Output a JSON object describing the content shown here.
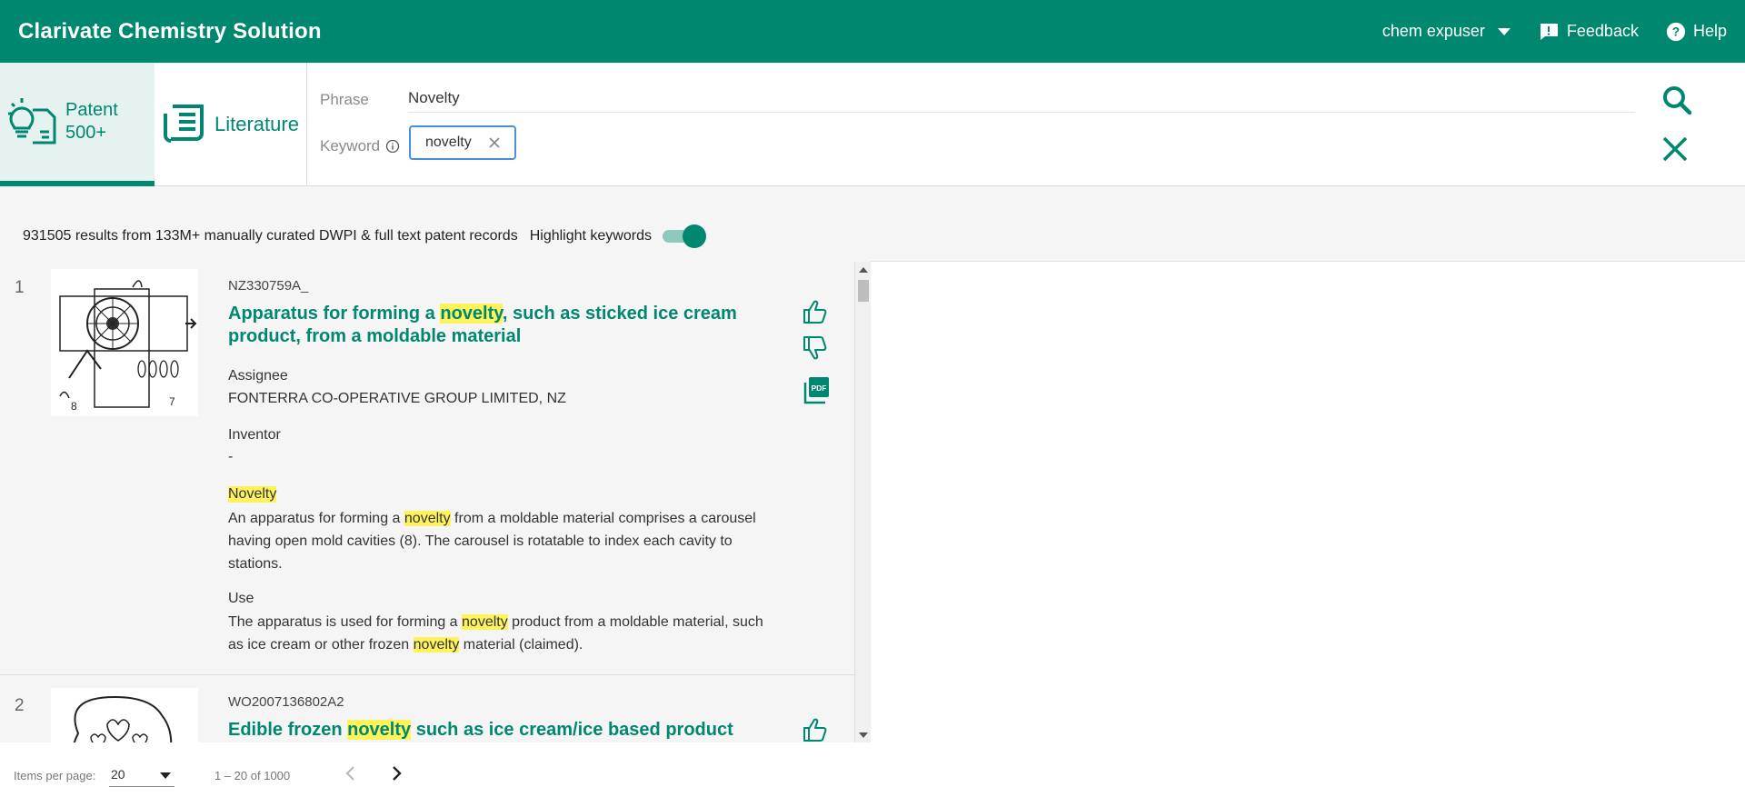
{
  "app": {
    "title": "Clarivate Chemistry Solution"
  },
  "header": {
    "user": "chem expuser",
    "feedback": "Feedback",
    "help": "Help"
  },
  "tabs": {
    "patent": {
      "line1": "Patent",
      "line2": "500+"
    },
    "literature": "Literature"
  },
  "search": {
    "phrase_label": "Phrase",
    "phrase_value": "Novelty",
    "keyword_label": "Keyword",
    "keyword_chip": "novelty"
  },
  "results": {
    "summary": "931505 results from 133M+ manually curated DWPI & full text patent records",
    "highlight_label": "Highlight keywords",
    "highlight_on": true
  },
  "items": [
    {
      "num": "1",
      "patent_number": "NZ330759A_",
      "title_parts": [
        "Apparatus for forming a ",
        "novelty",
        ", such as sticked ice cream product, from a moldable material"
      ],
      "assignee_label": "Assignee",
      "assignee": "FONTERRA CO-OPERATIVE GROUP LIMITED, NZ",
      "inventor_label": "Inventor",
      "inventor": "-",
      "novelty_label": "Novelty",
      "novelty_parts": [
        "An apparatus for forming a ",
        "novelty",
        " from a moldable material comprises a carousel having open mold cavities (8). The carousel is rotatable to index each cavity to stations."
      ],
      "use_label": "Use",
      "use_parts": [
        "The apparatus is used for forming a ",
        "novelty",
        " product from a moldable material, such as ice cream or other frozen ",
        "novelty",
        " material (claimed)."
      ]
    },
    {
      "num": "2",
      "patent_number": "WO2007136802A2",
      "title_parts": [
        "Edible frozen ",
        "novelty",
        " such as ice cream/ice based product for"
      ]
    }
  ],
  "footer": {
    "items_per_page_label": "Items per page:",
    "items_per_page": "20",
    "range": "1 – 20 of 1000"
  },
  "colors": {
    "brand": "#00876f",
    "highlight": "#fff35c",
    "chip_border": "#4a90d9"
  },
  "icons": [
    "bulb-document-icon",
    "newspaper-icon",
    "info-icon",
    "close-icon",
    "search-icon",
    "thumbs-up-icon",
    "thumbs-down-icon",
    "pdf-icon",
    "feedback-icon",
    "help-icon",
    "chevron-left-icon",
    "chevron-right-icon"
  ]
}
